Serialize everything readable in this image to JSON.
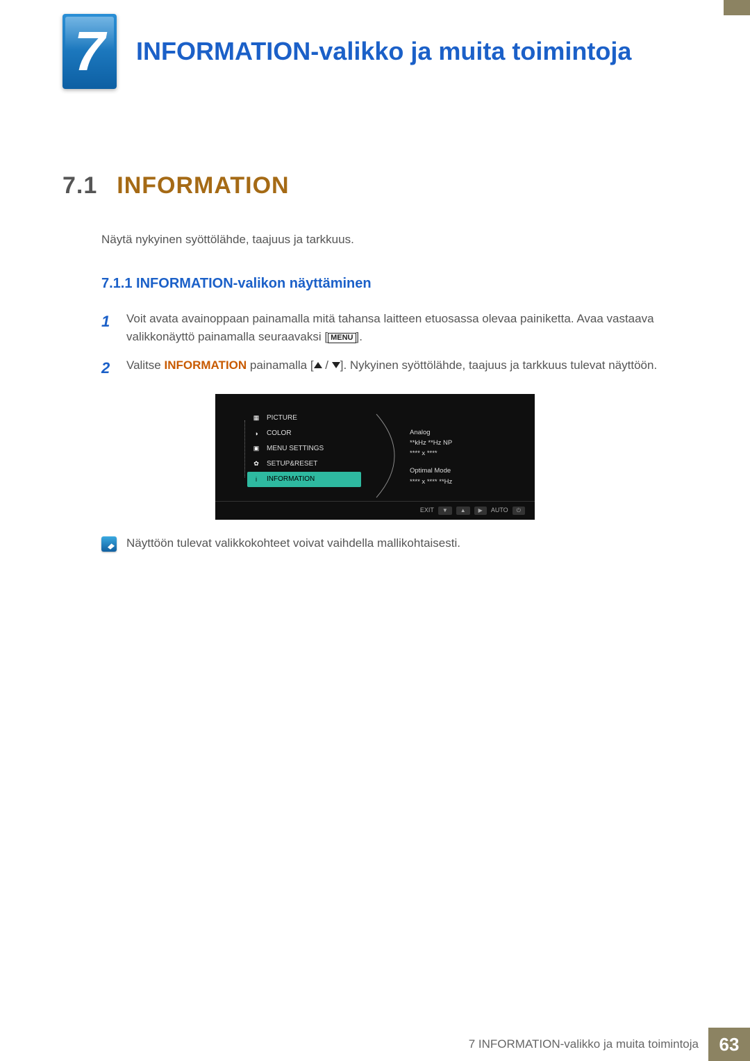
{
  "chapter": {
    "number": "7",
    "title": "INFORMATION-valikko ja muita toimintoja"
  },
  "section": {
    "number": "7.1",
    "title": "INFORMATION"
  },
  "intro": "Näytä nykyinen syöttölähde, taajuus ja tarkkuus.",
  "subsection": {
    "number": "7.1.1",
    "title": "INFORMATION-valikon näyttäminen"
  },
  "steps": {
    "s1": {
      "num": "1",
      "text_a": "Voit avata avainoppaan painamalla mitä tahansa laitteen etuosassa olevaa painiketta. Avaa vastaava valikkonäyttö painamalla seuraavaksi [",
      "menu": "MENU",
      "text_b": "]."
    },
    "s2": {
      "num": "2",
      "text_a": "Valitse ",
      "kw": "INFORMATION",
      "text_b": " painamalla [",
      "text_c": "]. Nykyinen syöttölähde, taajuus ja tarkkuus tulevat näyttöön."
    }
  },
  "osd": {
    "items": [
      "PICTURE",
      "COLOR",
      "MENU SETTINGS",
      "SETUP&RESET",
      "INFORMATION"
    ],
    "info": {
      "l1": "Analog",
      "l2": "**kHz  **Hz NP",
      "l3": "**** x ****",
      "l4": "Optimal Mode",
      "l5": "**** x ****  **Hz"
    },
    "footer": {
      "exit": "EXIT",
      "auto": "AUTO"
    }
  },
  "note": "Näyttöön tulevat valikkokohteet voivat vaihdella mallikohtaisesti.",
  "footer": {
    "text": "7 INFORMATION-valikko ja muita toimintoja",
    "page": "63"
  }
}
